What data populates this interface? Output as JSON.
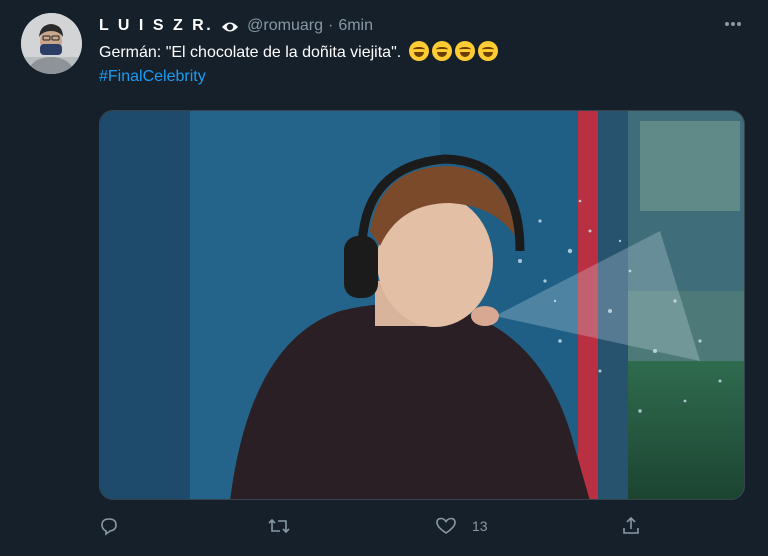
{
  "tweet": {
    "author_name": "L U I S Z R.",
    "handle": "@romuarg",
    "separator": "·",
    "time": "6min",
    "text": "Germán: \"El chocolate de la doñita viejita\".",
    "hashtag": "#FinalCelebrity"
  },
  "actions": {
    "like_count": "13"
  },
  "icons": {
    "author_badge": "eye-icon",
    "more": "more-horizontal-icon",
    "reply": "reply-icon",
    "retweet": "retweet-icon",
    "like": "heart-icon",
    "share": "share-icon"
  },
  "colors": {
    "background": "#15202b",
    "secondary_text": "#8899a6",
    "link": "#1d9bf0"
  }
}
